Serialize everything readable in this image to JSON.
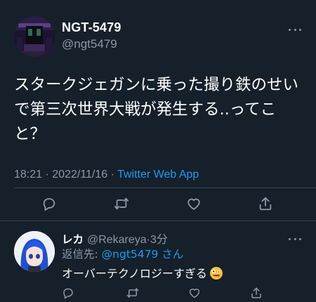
{
  "colors": {
    "background": "#15202b",
    "primary_text": "#ffffff",
    "secondary_text": "#8b98a5",
    "accent": "#1d9bf0",
    "divider": "#38444d"
  },
  "tweet": {
    "display_name": "NGT-5479",
    "handle": "@ngt5479",
    "text": "スタークジェガンに乗った撮り鉄のせいで第三次世界大戦が発生する..ってこと？",
    "time": "18:21",
    "date": "2022/11/16",
    "separator": "·",
    "source": "Twitter Web App",
    "icons": {
      "more": "more-horizontal-icon",
      "reply": "reply-icon",
      "retweet": "retweet-icon",
      "like": "heart-icon",
      "share": "share-icon"
    }
  },
  "reply": {
    "display_name": "レカ",
    "handle": "@Rekareya",
    "separator": "·",
    "age": "3分",
    "reply_label": "返信先:",
    "reply_mention": "@ngt5479 さん",
    "text": "オーバーテクノロジーすぎる",
    "emoji": "zany-face-icon"
  }
}
